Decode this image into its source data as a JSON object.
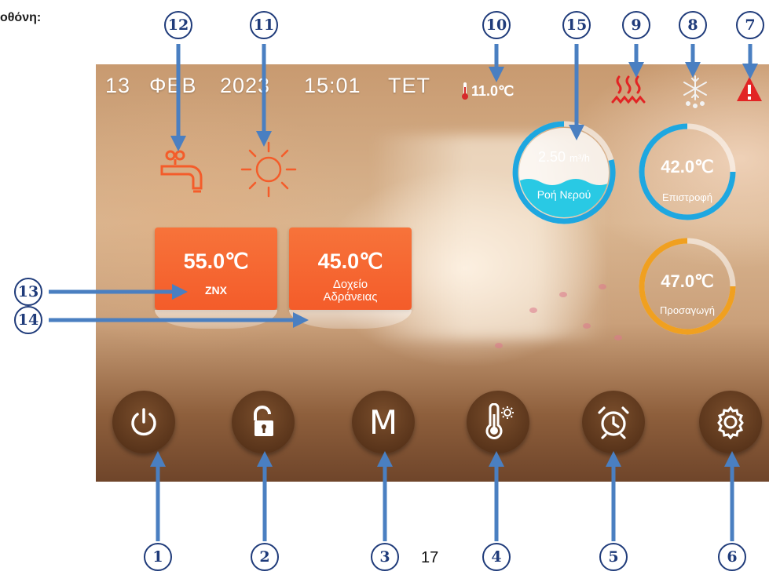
{
  "document": {
    "heading": "οθόνη:",
    "page_number": "17"
  },
  "status_bar": {
    "day": "13",
    "month": "ΦΕΒ",
    "year": "2023",
    "time": "15:01",
    "weekday": "ΤΕΤ",
    "outdoor_temp": "11.0℃"
  },
  "tiles": {
    "dhw": {
      "temp": "55.0℃",
      "label": "ZNX"
    },
    "buffer": {
      "temp": "45.0℃",
      "label_line1": "Δοχείο",
      "label_line2": "Αδράνειας"
    }
  },
  "gauges": {
    "flow": {
      "value": "2.50",
      "unit": "m³/h",
      "label": "Ροή Νερού"
    },
    "return": {
      "value": "42.0℃",
      "label": "Επιστροφή"
    },
    "supply": {
      "value": "47.0℃",
      "label": "Προσαγωγή"
    }
  },
  "callouts": [
    "1",
    "2",
    "3",
    "4",
    "5",
    "6",
    "7",
    "8",
    "9",
    "10",
    "11",
    "12",
    "13",
    "14",
    "15"
  ],
  "buttons": {
    "mode_label": "M"
  },
  "colors": {
    "accent_orange": "#f45c2a",
    "callout_blue": "#1f3b7a",
    "arrow_blue": "#4a7fc1",
    "gauge_blue": "#1ea7e0",
    "gauge_orange": "#f0a020",
    "button_brown": "#5a351b",
    "warning_red": "#e22424"
  },
  "icons": [
    "power-icon",
    "unlock-icon",
    "thermometer-settings-icon",
    "alarm-clock-icon",
    "gear-icon",
    "warning-icon",
    "defrost-icon",
    "heating-icon",
    "thermometer-icon",
    "sun-icon",
    "faucet-icon"
  ]
}
